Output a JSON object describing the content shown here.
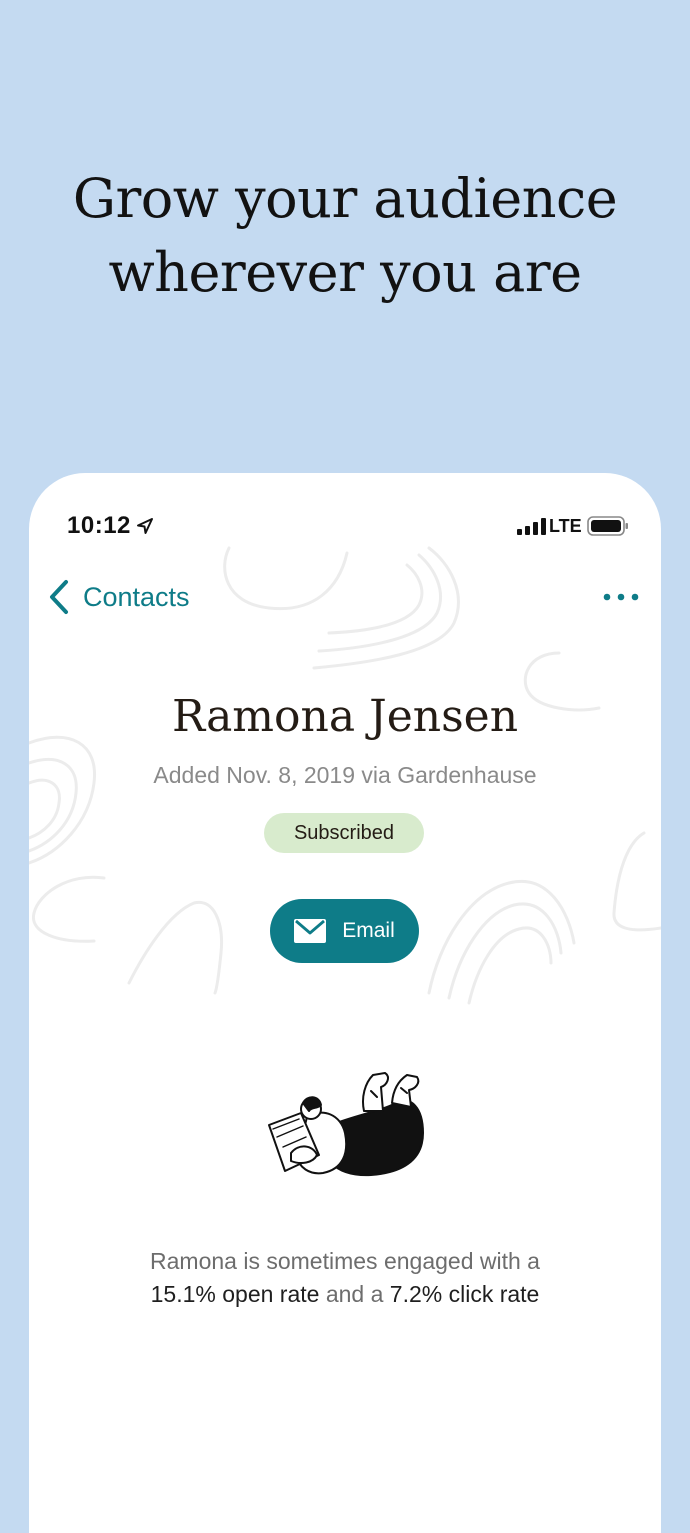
{
  "hero": {
    "line1": "Grow your audience",
    "line2": "wherever you are"
  },
  "status_bar": {
    "time": "10:12",
    "network": "LTE",
    "location_icon": "location-arrow-icon",
    "signal_icon": "cellular-signal-icon",
    "battery_icon": "battery-icon"
  },
  "nav": {
    "back_label": "Contacts",
    "back_icon": "chevron-left-icon",
    "more_icon": "more-dots-icon"
  },
  "contact": {
    "name": "Ramona Jensen",
    "added": "Added Nov. 8, 2019 via Gardenhause",
    "status": "Subscribed",
    "email_label": "Email",
    "email_icon": "envelope-icon"
  },
  "engagement": {
    "prefix": "Ramona is sometimes engaged with a",
    "open_rate": "15.1% open rate",
    "middle": "and a",
    "click_rate": "7.2% click rate"
  },
  "colors": {
    "background": "#c4daf1",
    "accent": "#0e7c88",
    "badge": "#d8ebcd"
  }
}
